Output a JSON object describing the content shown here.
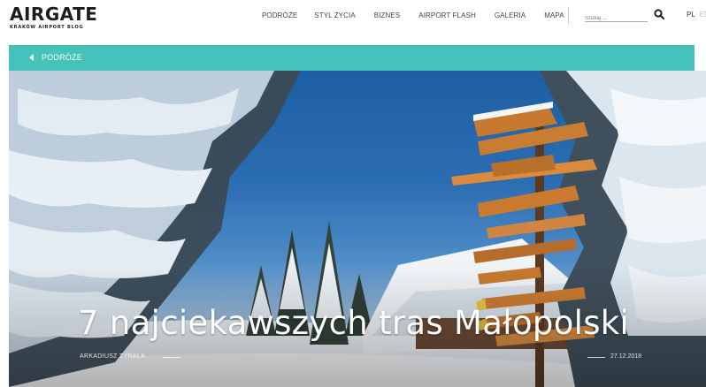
{
  "header": {
    "logo": "AIRGATE",
    "logo_sub": "KRAKÓW AIRPORT BLOG",
    "nav": [
      "PODRÓŻE",
      "STYL ŻYCIA",
      "BIZNES",
      "AIRPORT FLASH",
      "GALERIA",
      "MAPA"
    ],
    "search_placeholder": "Szukaj ...",
    "lang_active": "PL",
    "lang_other": "EN"
  },
  "category_bar": {
    "label": "PODRÓŻE",
    "color": "#45c2b9"
  },
  "hero": {
    "title": "7 najciekawszych tras Małopolski",
    "author": "ARKADIUSZ TYRAŁA",
    "date": "27.12.2018"
  }
}
